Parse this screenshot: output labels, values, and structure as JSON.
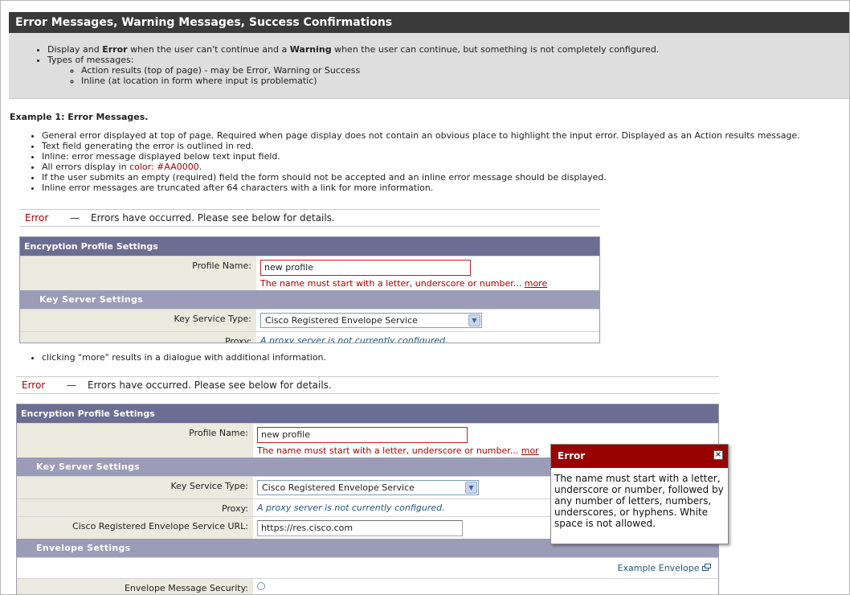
{
  "header": {
    "title": "Error Messages, Warning Messages, Success Confirmations"
  },
  "intro": {
    "bullet1": {
      "t1": "Display and ",
      "b1": "Error",
      "t2": " when the user can't continue and a ",
      "b2": "Warning",
      "t3": " when the user can continue, but something is not completely configured."
    },
    "bullet2": "Types of messages:",
    "sub1": "Action results (top of page) - may be Error, Warning or Success",
    "sub2": "Inline (at location in form where input is problematic)"
  },
  "example1": {
    "title": "Example 1: Error Messages.",
    "items": [
      "General error displayed at top of page. Required when page display does not contain an obvious place to highlight the input error. Displayed as an Action results message.",
      "Text field generating the error is outlined in red.",
      "Inline: error message displayed below text input field."
    ],
    "color_item_prefix": "All errors display in ",
    "color_item_red": "color: #AA0000",
    "color_item_suffix": ".",
    "items2": [
      "If the user submits an empty (required) field the form should not be accepted and an inline error message should be displayed.",
      "Inline error messages are truncated after 64 characters with a link for more information."
    ],
    "error_color": "#AA0000"
  },
  "error_bar": {
    "label": "Error",
    "dash": "—",
    "message": "Errors have occurred. Please see below for details."
  },
  "form": {
    "panel_title": "Encryption Profile Settings",
    "profile_name_label": "Profile Name:",
    "profile_name_value": "new profile",
    "profile_error": "The name must start with a letter, underscore or number...",
    "more_link": "more",
    "profile_error_truncated": "The name must start with a letter, underscore or number...",
    "more_link_truncated": "mor",
    "key_server_title": "Key Server Settings",
    "key_service_type_label": "Key Service Type:",
    "key_service_type_value": "Cisco Registered Envelope Service",
    "proxy_label": "Proxy:",
    "proxy_value": "A proxy server is not currently configured.",
    "url_label": "Cisco Registered Envelope Service URL:",
    "url_value": "https://res.cisco.com",
    "envelope_title": "Envelope Settings",
    "example_envelope_link": "Example Envelope",
    "envelope_security_label": "Envelope Message Security:"
  },
  "clicking_note": "clicking \"more\" results in a dialogue with additional information.",
  "popup": {
    "title": "Error",
    "close": "×",
    "body": "The name must start with a letter, underscore or number, followed by any number of letters, numbers, underscores, or hyphens. White space is not allowed."
  },
  "colors": {
    "header_bg": "#3a3a3a",
    "panel_title_bg": "#6b6d92",
    "subsection_bg": "#9b9cb8",
    "label_bg": "#eaeade",
    "error_red": "#aa0000",
    "popup_red": "#990000"
  }
}
